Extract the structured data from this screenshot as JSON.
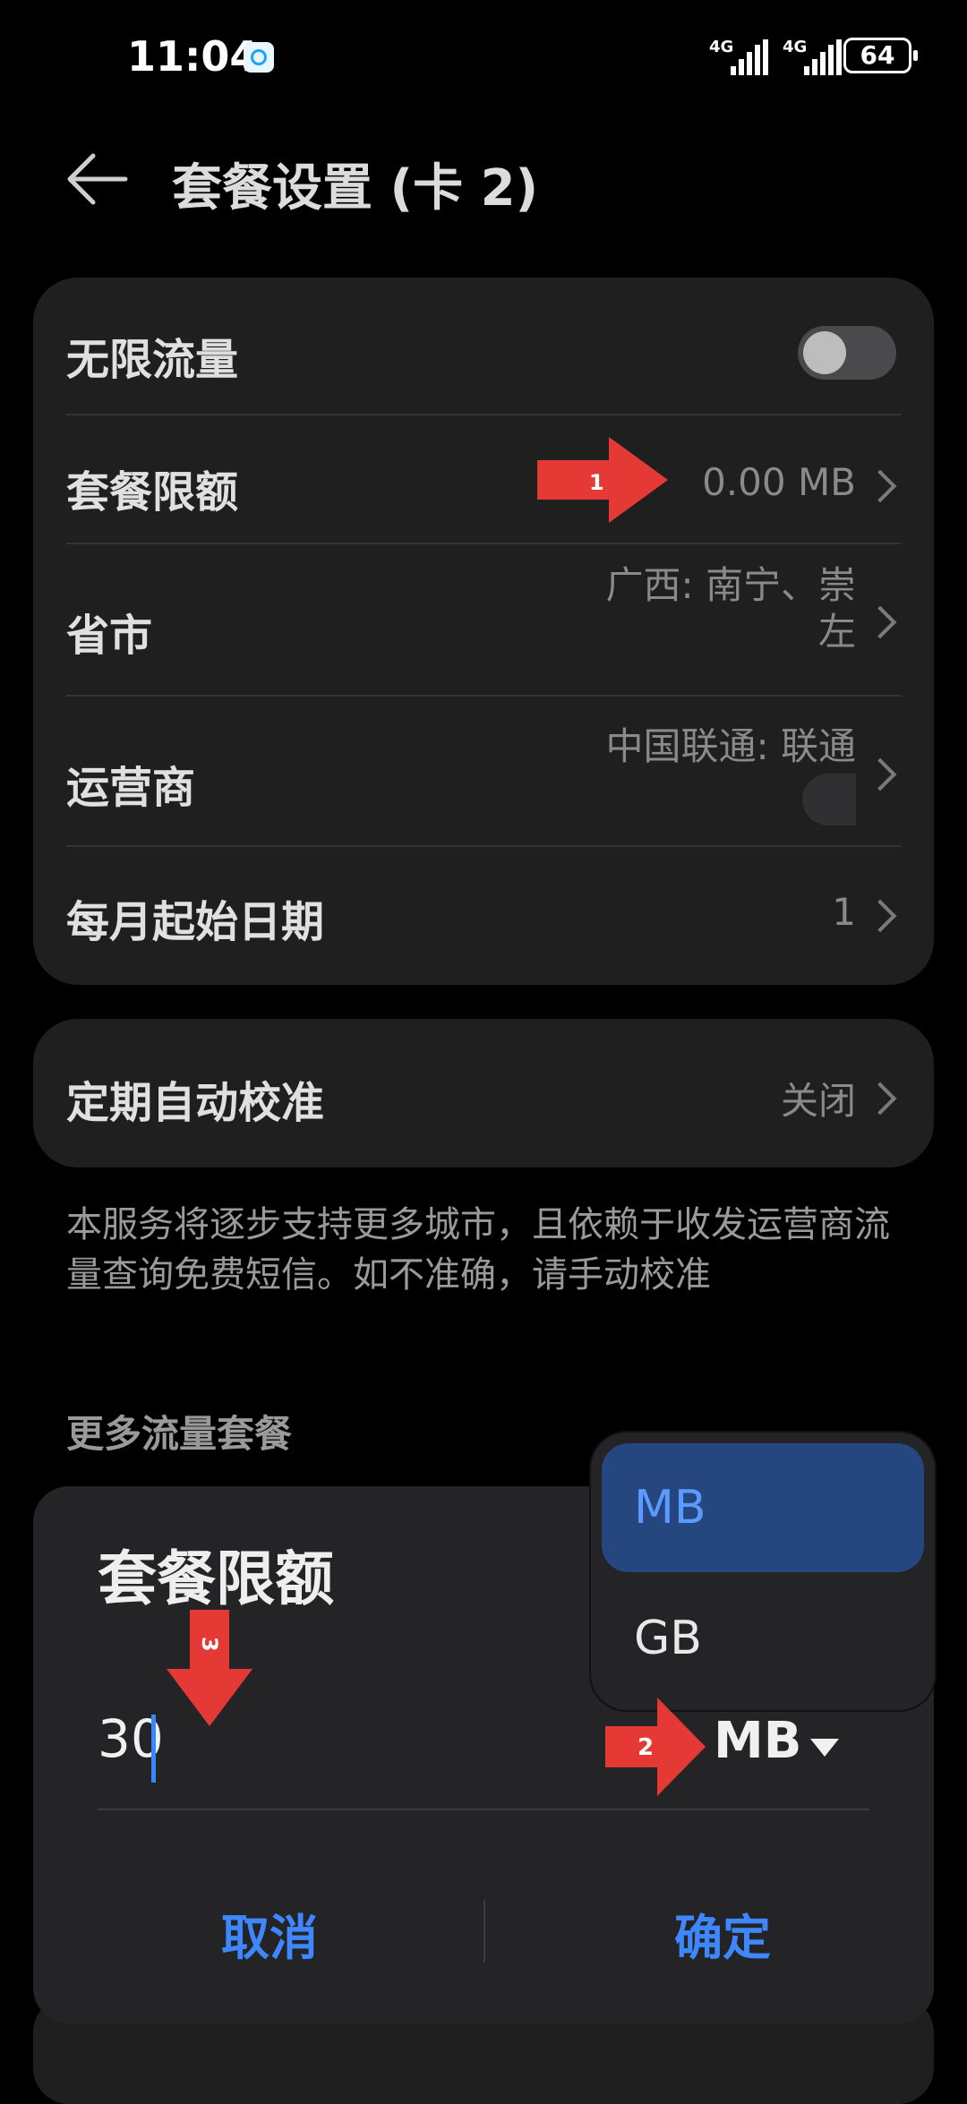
{
  "status_bar": {
    "time": "11:04",
    "network_1": "4G",
    "network_2": "4G",
    "battery": "64"
  },
  "header": {
    "title": "套餐设置 (卡 2)"
  },
  "settings": {
    "unlimited_label": "无限流量",
    "unlimited_on": false,
    "plan_limit_label": "套餐限额",
    "plan_limit_value": "0.00 MB",
    "province_label": "省市",
    "province_value_line1": "广西: 南宁、崇",
    "province_value_line2": "左",
    "carrier_label": "运营商",
    "carrier_value": "中国联通: 联通",
    "start_date_label": "每月起始日期",
    "start_date_value": "1"
  },
  "calibration": {
    "label": "定期自动校准",
    "value": "关闭"
  },
  "note": "本服务将逐步支持更多城市，且依赖于收发运营商流量查询免费短信。如不准确，请手动校准",
  "more_section": "更多流量套餐",
  "dialog": {
    "title": "套餐限额",
    "input_value": "30",
    "unit": "MB",
    "cancel": "取消",
    "confirm": "确定"
  },
  "dropdown": {
    "options": [
      "MB",
      "GB"
    ],
    "selected": "MB"
  },
  "annotations": {
    "arrow_1": "1",
    "arrow_2": "2",
    "arrow_3": "3",
    "color": "#e53935"
  }
}
